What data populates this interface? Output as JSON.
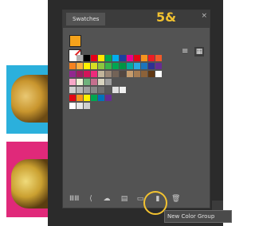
{
  "panel": {
    "tab_label": "Swatches",
    "close_icon": "×",
    "step_label": "5&"
  },
  "toolbar_icons": {
    "list_view": "≡",
    "grid_view": "▦"
  },
  "colors": {
    "fill": "#f6a31b",
    "panel_bg": "#535353",
    "highlight": "#f2c230"
  },
  "swatch_rows": [
    [
      "#ffffff",
      "#b0b0b0",
      "#000000",
      "#e6001a",
      "#ffe600",
      "#00a650",
      "#00aeef",
      "#1d3fa0",
      "#ec008c",
      "#e30613",
      "#f7941d",
      "#ed1c24",
      "#f15a29"
    ],
    [
      "#f5821f",
      "#fbb040",
      "#fff200",
      "#d7df23",
      "#8dc63f",
      "#39b54a",
      "#00a651",
      "#009444",
      "#00a99d",
      "#27aae1",
      "#1c75bc",
      "#2e3192",
      "#662d91"
    ],
    [
      "#92278f",
      "#9e1f63",
      "#d4145a",
      "#ee2a7b",
      "#c2b59b",
      "#998675",
      "#736357",
      "#534741",
      "#c69c6d",
      "#a67c52",
      "#8c6239",
      "#603813",
      "#ffffff"
    ],
    [
      "#f7a8c8",
      "#eef2d6",
      "#6fb27c",
      "#c56f8e",
      "#d8d4c0",
      "#9e9e9e"
    ],
    [
      "#d0d0d0",
      "#b8b8b8",
      "#a0a0a0",
      "#888888",
      "#707070",
      "#585858",
      "#e0e0e0",
      "#f0f0f0"
    ],
    [
      "#e30613",
      "#f7941d",
      "#fff200",
      "#00a650",
      "#0072bc",
      "#662d91"
    ],
    [
      "#ffffff",
      "#e8e8e8",
      "#cfcfcf"
    ]
  ],
  "bottom_icons": [
    "library-icon",
    "share-icon",
    "cloud-icon",
    "swatch-options-icon",
    "new-color-group-icon",
    "new-swatch-icon",
    "trash-icon"
  ],
  "tooltip": "New Color Group"
}
